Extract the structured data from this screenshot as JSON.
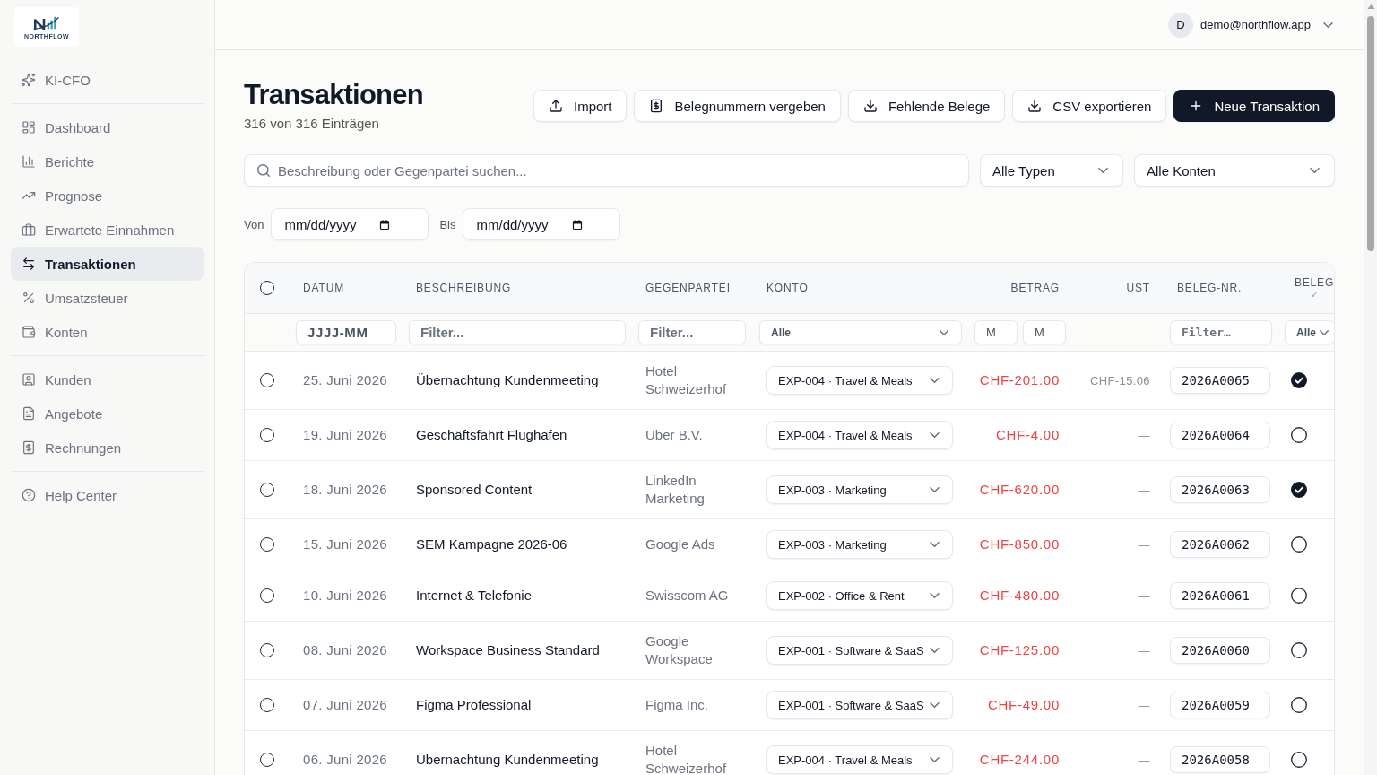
{
  "sidebar": {
    "logo": "NORTHFLOW",
    "groups": [
      {
        "items": [
          {
            "label": "KI-CFO",
            "selected": false
          }
        ]
      },
      {
        "items": [
          {
            "label": "Dashboard",
            "selected": false
          },
          {
            "label": "Berichte",
            "selected": false
          },
          {
            "label": "Prognose",
            "selected": false
          },
          {
            "label": "Erwartete Einnahmen",
            "selected": false
          },
          {
            "label": "Transaktionen",
            "selected": true
          },
          {
            "label": "Umsatzsteuer",
            "selected": false
          },
          {
            "label": "Konten",
            "selected": false
          }
        ]
      },
      {
        "items": [
          {
            "label": "Kunden",
            "selected": false
          },
          {
            "label": "Angebote",
            "selected": false
          },
          {
            "label": "Rechnungen",
            "selected": false
          }
        ]
      },
      {
        "items": [
          {
            "label": "Help Center",
            "selected": false
          }
        ]
      }
    ]
  },
  "header": {
    "user": {
      "initial": "D",
      "email": "demo@northflow.app"
    }
  },
  "page": {
    "title": "Transaktionen",
    "subtitle": "316 von 316 Einträgen"
  },
  "actions": [
    {
      "label": "Import",
      "kind": "secondary"
    },
    {
      "label": "Belegnummern vergeben",
      "kind": "secondary"
    },
    {
      "label": "Fehlende Belege",
      "kind": "secondary"
    },
    {
      "label": "CSV exportieren",
      "kind": "secondary"
    },
    {
      "label": "Neue Transaktion",
      "kind": "primary"
    }
  ],
  "filters": {
    "search": {
      "placeholder": "Beschreibung oder Gegenpartei suchen..."
    },
    "selects": [
      {
        "value": "Alle Typen"
      },
      {
        "value": "Alle Konten"
      }
    ],
    "dates": [
      {
        "label": "Von",
        "placeholder": "mm/dd/yyyy"
      },
      {
        "label": "Bis",
        "placeholder": "mm/dd/yyyy"
      }
    ]
  },
  "table": {
    "select_all": {
      "selected": false
    },
    "columns": [
      {
        "label": "DATUM",
        "filter": {
          "kind": "month",
          "placeholder": "JJJJ-MM"
        }
      },
      {
        "label": "BESCHREIBUNG",
        "filter": {
          "kind": "text",
          "placeholder": "Filter..."
        }
      },
      {
        "label": "GEGENPARTEI",
        "filter": {
          "kind": "text",
          "placeholder": "Filter..."
        }
      },
      {
        "label": "KONTO",
        "filter": {
          "kind": "select",
          "value": "Alle"
        }
      },
      {
        "label": "BETRAG",
        "filter": {
          "kind": "range",
          "placeholders": [
            "M",
            "M"
          ]
        }
      },
      {
        "label": "UST"
      },
      {
        "label": "BELEG-NR.",
        "filter": {
          "kind": "code",
          "placeholder": "Filter…"
        }
      },
      {
        "label": "BELEG",
        "mark": "✓",
        "filter": {
          "kind": "select",
          "value": "Alle"
        }
      }
    ],
    "rows": [
      {
        "selected": false,
        "date": "25. Juni 2026",
        "description": "Übernachtung Kundenmeeting",
        "counterparty": "Hotel Schweizerhof",
        "account": "EXP-004 · Travel & Meals",
        "amount": "CHF-201.00",
        "vat": "CHF-15.06",
        "receipt_no": "2026A0065",
        "receipt": true
      },
      {
        "selected": false,
        "date": "19. Juni 2026",
        "description": "Geschäftsfahrt Flughafen",
        "counterparty": "Uber B.V.",
        "account": "EXP-004 · Travel & Meals",
        "amount": "CHF-4.00",
        "vat": "—",
        "receipt_no": "2026A0064",
        "receipt": false
      },
      {
        "selected": false,
        "date": "18. Juni 2026",
        "description": "Sponsored Content",
        "counterparty": "LinkedIn Marketing",
        "account": "EXP-003 · Marketing",
        "amount": "CHF-620.00",
        "vat": "—",
        "receipt_no": "2026A0063",
        "receipt": true
      },
      {
        "selected": false,
        "date": "15. Juni 2026",
        "description": "SEM Kampagne 2026-06",
        "counterparty": "Google Ads",
        "account": "EXP-003 · Marketing",
        "amount": "CHF-850.00",
        "vat": "—",
        "receipt_no": "2026A0062",
        "receipt": false
      },
      {
        "selected": false,
        "date": "10. Juni 2026",
        "description": "Internet & Telefonie",
        "counterparty": "Swisscom AG",
        "account": "EXP-002 · Office & Rent",
        "amount": "CHF-480.00",
        "vat": "—",
        "receipt_no": "2026A0061",
        "receipt": false
      },
      {
        "selected": false,
        "date": "08. Juni 2026",
        "description": "Workspace Business Standard",
        "counterparty": "Google Workspace",
        "account": "EXP-001 · Software & SaaS",
        "amount": "CHF-125.00",
        "vat": "—",
        "receipt_no": "2026A0060",
        "receipt": false
      },
      {
        "selected": false,
        "date": "07. Juni 2026",
        "description": "Figma Professional",
        "counterparty": "Figma Inc.",
        "account": "EXP-001 · Software & SaaS",
        "amount": "CHF-49.00",
        "vat": "—",
        "receipt_no": "2026A0059",
        "receipt": false
      },
      {
        "selected": false,
        "date": "06. Juni 2026",
        "description": "Übernachtung Kundenmeeting",
        "counterparty": "Hotel Schweizerhof",
        "account": "EXP-004 · Travel & Meals",
        "amount": "CHF-244.00",
        "vat": "—",
        "receipt_no": "2026A0058",
        "receipt": false
      }
    ]
  }
}
